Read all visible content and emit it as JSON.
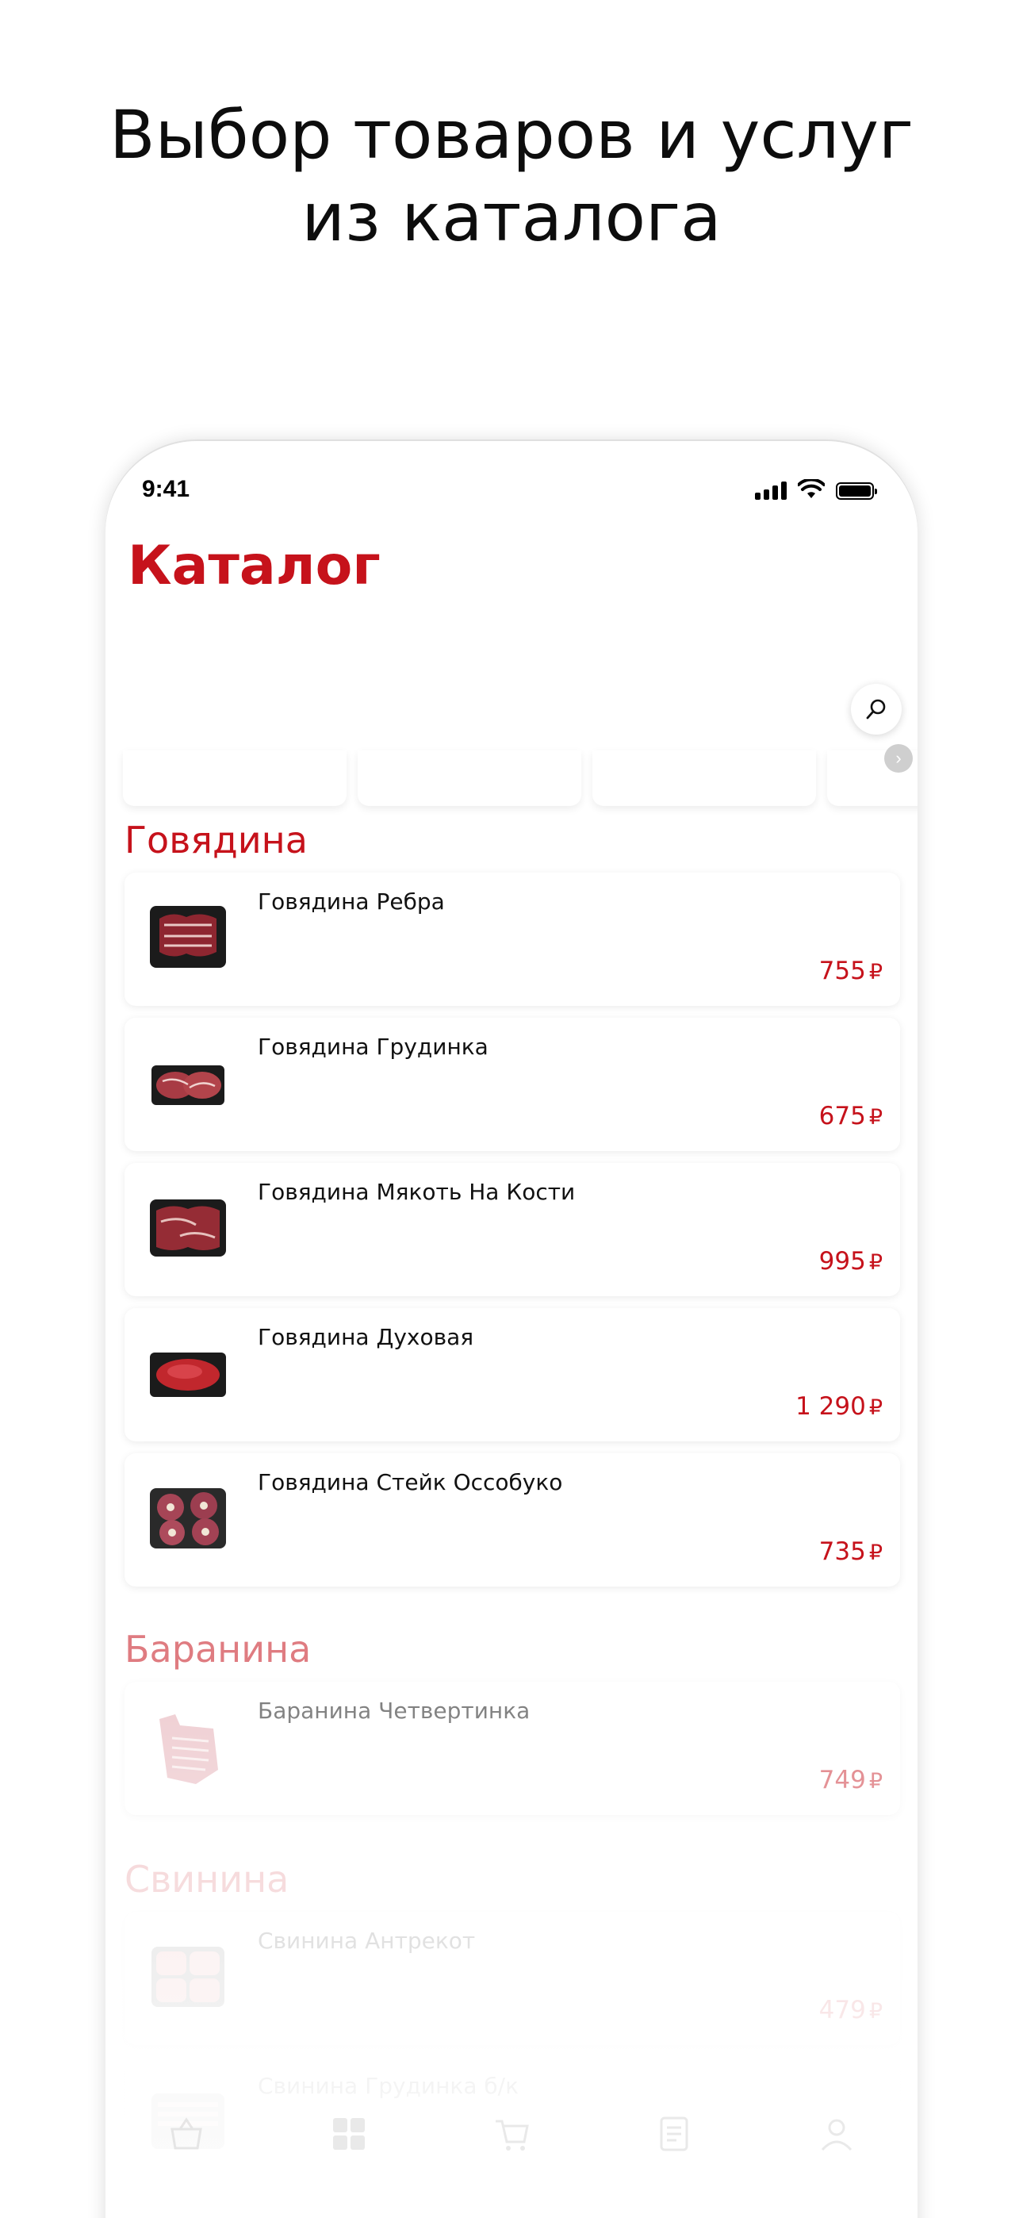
{
  "promo": {
    "title_line1": "Выбор товаров и услуг",
    "title_line2": "из каталога"
  },
  "status_bar": {
    "time": "9:41"
  },
  "catalog": {
    "title": "Каталог"
  },
  "sections": [
    {
      "title": "Говядина",
      "items": [
        {
          "name": "Говядина Ребра",
          "price": "755",
          "currency": "₽"
        },
        {
          "name": "Говядина Грудинка",
          "price": "675",
          "currency": "₽"
        },
        {
          "name": "Говядина Мякоть На Кости",
          "price": "995",
          "currency": "₽"
        },
        {
          "name": "Говядина Духовая",
          "price": "1 290",
          "currency": "₽"
        },
        {
          "name": "Говядина Стейк Оссобуко",
          "price": "735",
          "currency": "₽"
        }
      ]
    },
    {
      "title": "Баранина",
      "items": [
        {
          "name": "Баранина Четвертинка",
          "price": "749",
          "currency": "₽"
        }
      ]
    },
    {
      "title": "Свинина",
      "items": [
        {
          "name": "Свинина Антрекот",
          "price": "479",
          "currency": "₽"
        },
        {
          "name": "Свинина Грудинка б/к",
          "price": "",
          "currency": ""
        }
      ]
    }
  ],
  "icons": {
    "search": "search-icon",
    "strip_arrow": "chevron-right-icon",
    "tabs": [
      "basket-icon",
      "catalog-grid-icon",
      "cart-icon",
      "orders-icon",
      "profile-icon"
    ]
  },
  "colors": {
    "accent": "#c6121b",
    "text": "#111111"
  }
}
